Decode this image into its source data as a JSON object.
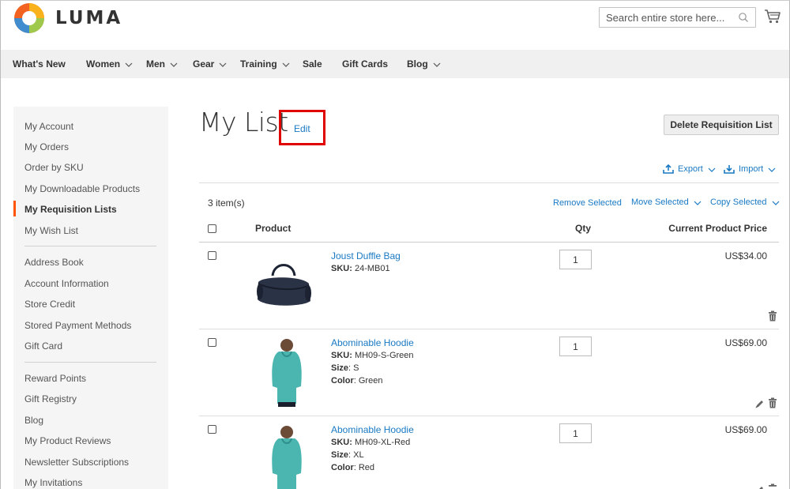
{
  "header": {
    "brand": "LUMA",
    "search_placeholder": "Search entire store here...",
    "cart_icon": "cart-icon",
    "colors": {
      "logo_orange": "#f26322",
      "logo_green": "#9ec94c",
      "logo_blue": "#3f8dcf",
      "logo_yellow": "#f9b21b"
    }
  },
  "nav": {
    "items": [
      {
        "label": "What's New",
        "dropdown": false
      },
      {
        "label": "Women",
        "dropdown": true
      },
      {
        "label": "Men",
        "dropdown": true
      },
      {
        "label": "Gear",
        "dropdown": true
      },
      {
        "label": "Training",
        "dropdown": true
      },
      {
        "label": "Sale",
        "dropdown": false
      },
      {
        "label": "Gift Cards",
        "dropdown": false
      },
      {
        "label": "Blog",
        "dropdown": true
      }
    ]
  },
  "sidebar": {
    "items": [
      {
        "label": "My Account"
      },
      {
        "label": "My Orders"
      },
      {
        "label": "Order by SKU"
      },
      {
        "label": "My Downloadable Products"
      },
      {
        "label": "My Requisition Lists",
        "active": true
      },
      {
        "label": "My Wish List"
      },
      {
        "label": "Address Book"
      },
      {
        "label": "Account Information"
      },
      {
        "label": "Store Credit"
      },
      {
        "label": "Stored Payment Methods"
      },
      {
        "label": "Gift Card"
      },
      {
        "label": "Reward Points"
      },
      {
        "label": "Gift Registry"
      },
      {
        "label": "Blog"
      },
      {
        "label": "My Product Reviews"
      },
      {
        "label": "Newsletter Subscriptions"
      },
      {
        "label": "My Invitations"
      }
    ],
    "accent_color": "#ff5501"
  },
  "main": {
    "title": "My List",
    "edit_label": "Edit",
    "delete_label": "Delete Requisition List",
    "export_label": "Export",
    "import_label": "Import",
    "item_count": "3 item(s)",
    "remove_selected": "Remove Selected",
    "move_selected": "Move Selected",
    "copy_selected": "Copy Selected",
    "columns": {
      "product": "Product",
      "qty": "Qty",
      "price": "Current Product Price"
    },
    "link_color": "#1979c3",
    "rows": [
      {
        "name": "Joust Duffle Bag",
        "sku_label": "SKU:",
        "sku": "24-MB01",
        "qty": "1",
        "price": "US$34.00",
        "thumb": "duffle-bag-thumbnail"
      },
      {
        "name": "Abominable Hoodie",
        "sku_label": "SKU:",
        "sku": "MH09-S-Green",
        "size_label": "Size",
        "size": "S",
        "color_label": "Color",
        "color": "Green",
        "qty": "1",
        "price": "US$69.00",
        "thumb": "hoodie-thumbnail"
      },
      {
        "name": "Abominable Hoodie",
        "sku_label": "SKU:",
        "sku": "MH09-XL-Red",
        "size_label": "Size",
        "size": "XL",
        "color_label": "Color",
        "color": "Red",
        "qty": "1",
        "price": "US$69.00",
        "thumb": "hoodie-thumbnail"
      }
    ]
  }
}
